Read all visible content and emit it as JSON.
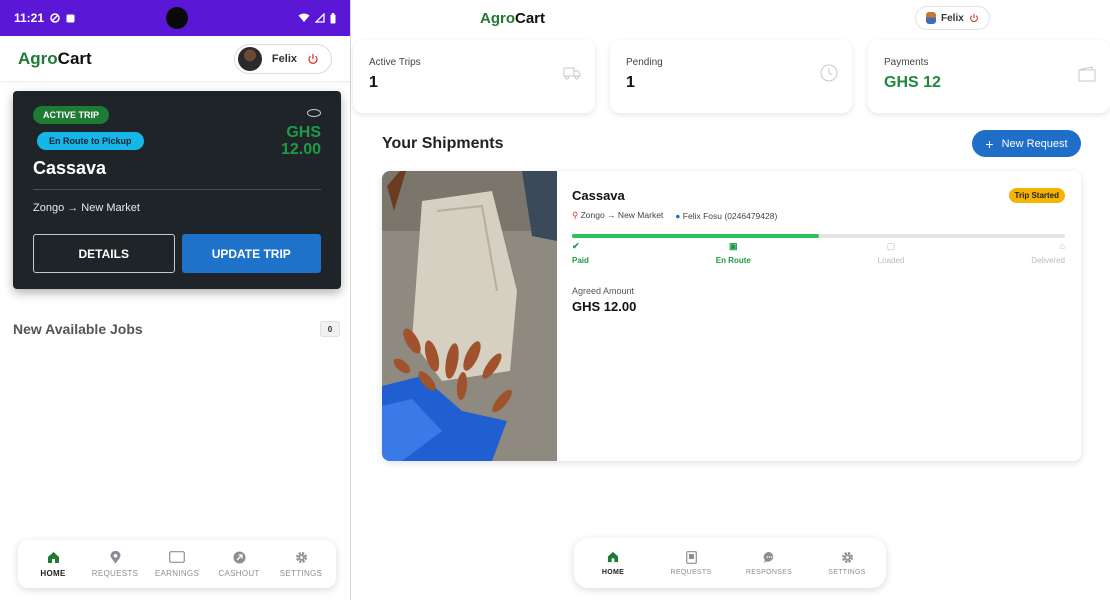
{
  "phone": {
    "status_bar": {
      "time": "11:21"
    },
    "brand": {
      "part1": "Agro",
      "part2": "Cart"
    },
    "user": {
      "name": "Felix"
    },
    "active_trip": {
      "badge": "ACTIVE TRIP",
      "status": "En Route to Pickup",
      "title": "Cassava",
      "amount_currency": "GHS",
      "amount_value": "12.00",
      "route": "Zongo → New Market",
      "details_label": "DETAILS",
      "update_label": "UPDATE TRIP"
    },
    "jobs": {
      "title": "New Available Jobs",
      "count": "0"
    },
    "nav": {
      "items": [
        {
          "label": "HOME",
          "icon": "home-icon"
        },
        {
          "label": "REQUESTS",
          "icon": "location-pin-icon"
        },
        {
          "label": "EARNINGS",
          "icon": "wallet-icon"
        },
        {
          "label": "CASHOUT",
          "icon": "cashout-icon"
        },
        {
          "label": "SETTINGS",
          "icon": "gear-icon"
        }
      ]
    }
  },
  "web": {
    "brand": {
      "part1": "Agro",
      "part2": "Cart"
    },
    "user": {
      "name": "Felix"
    },
    "stats": [
      {
        "label": "Active Trips",
        "value": "1",
        "icon": "truck-icon"
      },
      {
        "label": "Pending",
        "value": "1",
        "icon": "clock-icon"
      },
      {
        "label": "Payments",
        "value": "GHS 12",
        "icon": "wallet-icon"
      }
    ],
    "shipments_title": "Your Shipments",
    "new_request_label": "New Request",
    "shipment": {
      "name": "Cassava",
      "badge": "Trip Started",
      "route": "Zongo → New Market",
      "contact": "Felix Fosu (0246479428)",
      "progress": 0.5,
      "steps": [
        {
          "label": "Paid",
          "done": true
        },
        {
          "label": "En Route",
          "done": true
        },
        {
          "label": "Loaded",
          "done": false
        },
        {
          "label": "Delivered",
          "done": false
        }
      ],
      "agreed_label": "Agreed Amount",
      "agreed_value": "GHS 12.00"
    },
    "nav": {
      "items": [
        {
          "label": "HOME",
          "icon": "home-icon"
        },
        {
          "label": "REQUESTS",
          "icon": "document-icon"
        },
        {
          "label": "RESPONSES",
          "icon": "chat-icon"
        },
        {
          "label": "SETTINGS",
          "icon": "gear-icon"
        }
      ]
    }
  },
  "colors": {
    "brand_green": "#1e7b34",
    "primary_blue": "#1f6fc9",
    "status_purple": "#5b17d6",
    "progress_green": "#2cbf5a"
  }
}
